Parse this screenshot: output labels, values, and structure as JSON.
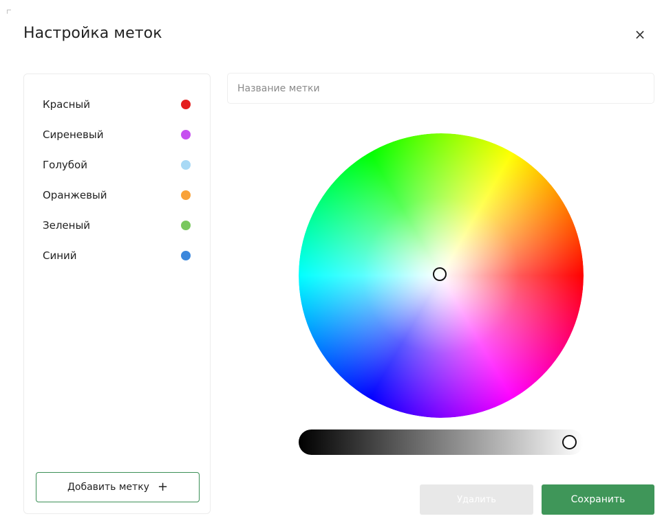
{
  "dialog": {
    "title": "Настройка меток",
    "close_icon": "close-icon",
    "close_glyph": "×"
  },
  "labels": [
    {
      "name": "Красный",
      "color": "#e41e1e"
    },
    {
      "name": "Сиреневый",
      "color": "#c64ff0"
    },
    {
      "name": "Голубой",
      "color": "#a8d9f5"
    },
    {
      "name": "Оранжевый",
      "color": "#f8a23a"
    },
    {
      "name": "Зеленый",
      "color": "#79c75e"
    },
    {
      "name": "Синий",
      "color": "#3b87dc"
    }
  ],
  "add_label": {
    "label": "Добавить метку",
    "icon": "plus-icon",
    "glyph": "+"
  },
  "editor": {
    "name_input": {
      "placeholder": "Название метки",
      "value": ""
    },
    "brightness": 1.0
  },
  "actions": {
    "delete_label": "Удалить",
    "save_label": "Сохранить"
  },
  "colors": {
    "accent": "#3f9659",
    "add_button_border": "#3a8e55",
    "disabled_button": "#e8e8e8"
  }
}
